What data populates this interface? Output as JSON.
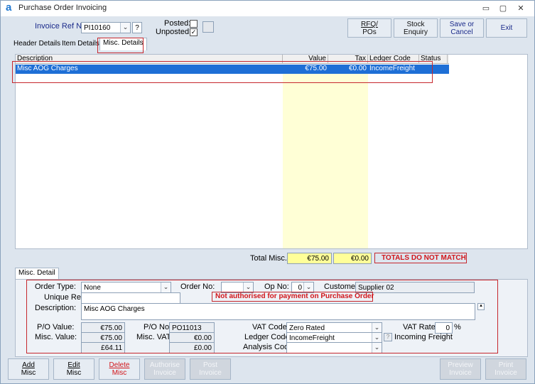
{
  "window": {
    "title": "Purchase Order Invoicing",
    "logo": "a",
    "min": "▭",
    "max": "▢",
    "close": "✕"
  },
  "toolbar": {
    "invoice_ref_label": "Invoice Ref No:",
    "invoice_ref_value": "PI10160",
    "help": "?",
    "posted_label": "Posted:",
    "unposted_label": "Unposted:",
    "unposted_check": "✓",
    "rfq_line1": "RFQ/",
    "rfq_line2": "POs",
    "stock_line1": "Stock",
    "stock_line2": "Enquiry",
    "save_line1": "Save or",
    "save_line2": "Cancel",
    "exit": "Exit"
  },
  "tabs": [
    {
      "label": "Header Details"
    },
    {
      "label": "Item Details"
    },
    {
      "label": "Misc. Details"
    }
  ],
  "grid": {
    "headers": [
      "Description",
      "Value",
      "Tax",
      "Ledger Code",
      "Status"
    ],
    "rows": [
      {
        "description": "Misc AOG Charges",
        "value": "€75.00",
        "tax": "€0.00",
        "ledger": "IncomeFreight",
        "status": ""
      }
    ]
  },
  "totals": {
    "label": "Total Misc.:",
    "value": "€75.00",
    "tax": "€0.00",
    "warning": "TOTALS DO NOT MATCH"
  },
  "detail": {
    "tab": "Misc. Detail",
    "order_type_label": "Order Type:",
    "order_type_value": "None",
    "order_no_label": "Order No:",
    "order_no_value": "",
    "op_no_label": "Op No:",
    "op_no_value": "0",
    "customer_label": "Customer:",
    "customer_value": "Supplier 02",
    "unique_ref_label": "Unique Ref:",
    "unique_ref_value": "",
    "auth_warning": "Not authorised for payment on Purchase Order",
    "description_label": "Description:",
    "description_value": "Misc AOG Charges",
    "po_value_label": "P/O Value:",
    "po_value": "€75.00",
    "po_no_label": "P/O No:",
    "po_no": "PO11013",
    "vat_code_label": "VAT Code:",
    "vat_code": "Zero Rated",
    "vat_rate_label": "VAT Rate:",
    "vat_rate": "0",
    "percent": "%",
    "misc_value_label": "Misc. Value:",
    "misc_value": "€75.00",
    "misc_vat_label": "Misc. VAT:",
    "misc_vat": "€0.00",
    "ledger_code_label": "Ledger Code:",
    "ledger_code": "IncomeFreight",
    "ledger_desc": "Incoming Freight",
    "total_value": "£64.11",
    "total_vat": "£0.00",
    "analysis_code_label": "Analysis Code:",
    "analysis_code": ""
  },
  "buttons": {
    "add_1": "Add",
    "add_2": "Misc",
    "edit_1": "Edit",
    "edit_2": "Misc",
    "delete_1": "Delete",
    "delete_2": "Misc",
    "authorise_1": "Authorise",
    "authorise_2": "Invoice",
    "post_1": "Post",
    "post_2": "Invoice",
    "preview_1": "Preview",
    "preview_2": "Invoice",
    "print_1": "Print",
    "print_2": "Invoice"
  },
  "colors": {
    "accent": "#1e6fd6",
    "warning": "#d2161b",
    "highlight": "#ffff99"
  }
}
